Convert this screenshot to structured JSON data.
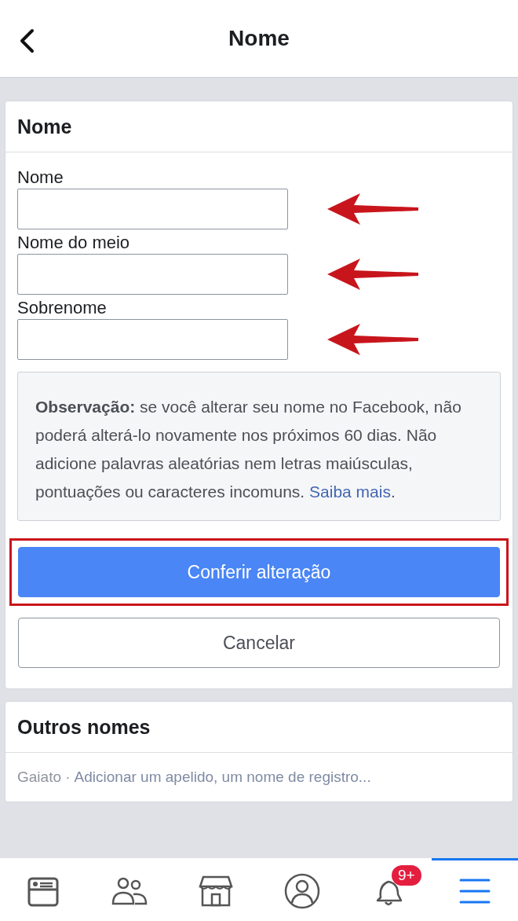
{
  "header": {
    "title": "Nome"
  },
  "name_card": {
    "title": "Nome",
    "fields": [
      {
        "label": "Nome",
        "arrow": true
      },
      {
        "label": "Nome do meio",
        "arrow": true
      },
      {
        "label": "Sobrenome",
        "arrow": true
      }
    ],
    "note": {
      "text": "**Observação:** se você alterar seu nome no Facebook, não poderá alterá-lo novamente nos próximos 60 dias. Não adicione palavras aleatórias nem letras maiúsculas, pontuações ou caracteres incomuns.",
      "link": "Saiba mais",
      "after": "."
    },
    "buttons": [
      {
        "kind": "primary",
        "label": "Conferir alteração",
        "highlighted": true
      },
      {
        "kind": "secondary",
        "label": "Cancelar",
        "highlighted": false
      }
    ]
  },
  "other_names": {
    "title": "Outros nomes",
    "current": "Gaiato ·",
    "add_link": "Adicionar um apelido, um nome de registro..."
  },
  "tab_bar": [
    {
      "kind": "feed",
      "selected": false
    },
    {
      "kind": "friends",
      "selected": false
    },
    {
      "kind": "market",
      "selected": false
    },
    {
      "kind": "profile",
      "selected": false
    },
    {
      "kind": "bell",
      "selected": false,
      "badge": "9+"
    },
    {
      "kind": "menu",
      "selected": true
    }
  ]
}
